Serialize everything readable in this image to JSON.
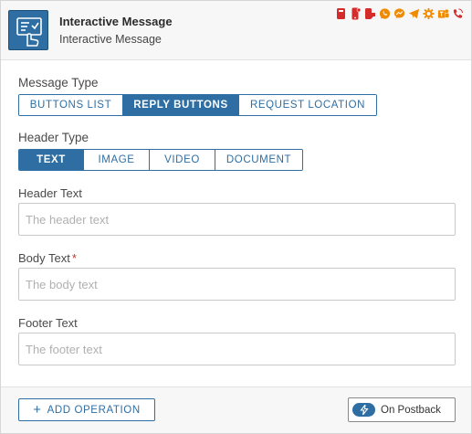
{
  "node": {
    "title": "Interactive Message",
    "subtitle": "Interactive Message",
    "icon": "interactive-message-icon",
    "accent_color": "#2e6ea3"
  },
  "channels": [
    {
      "name": "sms-icon",
      "color": "#d62b2b"
    },
    {
      "name": "mobile-push-icon",
      "color": "#d62b2b"
    },
    {
      "name": "rcs-icon",
      "color": "#d62b2b"
    },
    {
      "name": "whatsapp-icon",
      "color": "#f08a00"
    },
    {
      "name": "messenger-icon",
      "color": "#f08a00"
    },
    {
      "name": "telegram-icon",
      "color": "#f08a00"
    },
    {
      "name": "webhook-icon",
      "color": "#f08a00"
    },
    {
      "name": "teams-icon",
      "color": "#f08a00"
    },
    {
      "name": "viber-icon",
      "color": "#d62b2b"
    }
  ],
  "message_type": {
    "label": "Message Type",
    "options": [
      "Buttons List",
      "Reply Buttons",
      "Request Location"
    ],
    "selected": "Reply Buttons"
  },
  "header_type": {
    "label": "Header Type",
    "options": [
      "Text",
      "Image",
      "Video",
      "Document"
    ],
    "selected": "Text"
  },
  "fields": {
    "header_text": {
      "label": "Header Text",
      "placeholder": "The header text",
      "value": ""
    },
    "body_text": {
      "label": "Body Text",
      "required_mark": "*",
      "placeholder": "The body text",
      "value": ""
    },
    "footer_text": {
      "label": "Footer Text",
      "placeholder": "The footer text",
      "value": ""
    }
  },
  "footer": {
    "add_operation_label": "ADD OPERATION",
    "postback_label": "On Postback",
    "postback_icon": "lightning-icon"
  }
}
